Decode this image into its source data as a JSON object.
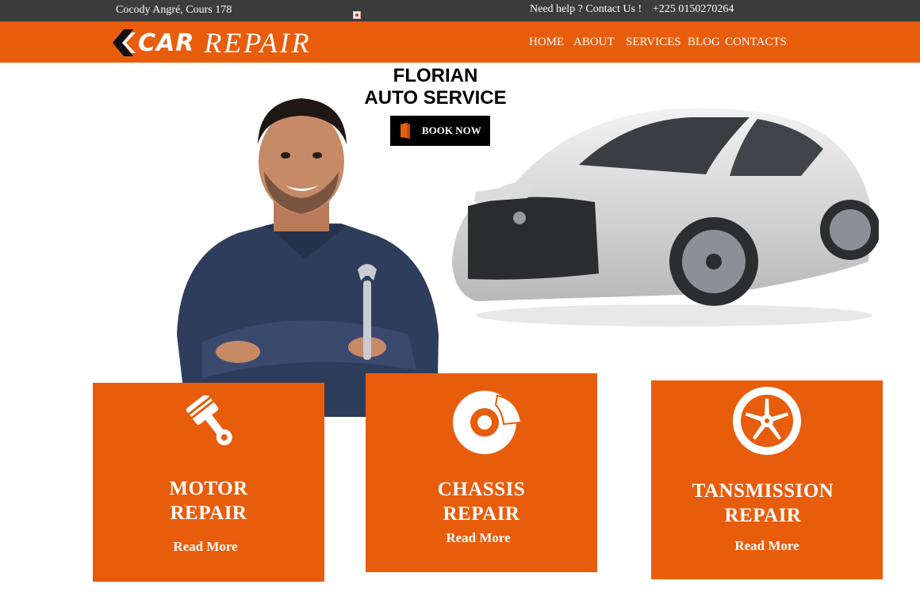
{
  "topbar": {
    "address": "Cocody Angré, Cours 178",
    "help": "Need help ? Contact Us !",
    "phone": "+225 0150270264"
  },
  "logo": {
    "part1": "CAR",
    "part2": "REPAIR"
  },
  "nav": [
    {
      "label": "HOME"
    },
    {
      "label": "ABOUT"
    },
    {
      "label": "SERVICES"
    },
    {
      "label": "BLOG"
    },
    {
      "label": "CONTACTS"
    }
  ],
  "hero": {
    "title_line1": "FLORIAN",
    "title_line2": "AUTO SERVICE",
    "book_label": "BOOK NOW"
  },
  "services": [
    {
      "line1": "MOTOR",
      "line2": "REPAIR",
      "more": "Read More",
      "icon": "piston-icon"
    },
    {
      "line1": "CHASSIS",
      "line2": "REPAIR",
      "more": "Read More",
      "icon": "brake-disc-icon"
    },
    {
      "line1": "TANSMISSION",
      "line2": "REPAIR",
      "more": "Read More",
      "icon": "wheel-rim-icon"
    }
  ],
  "colors": {
    "accent": "#e85d0c",
    "topbar": "#3c3c3c",
    "button": "#000000"
  }
}
